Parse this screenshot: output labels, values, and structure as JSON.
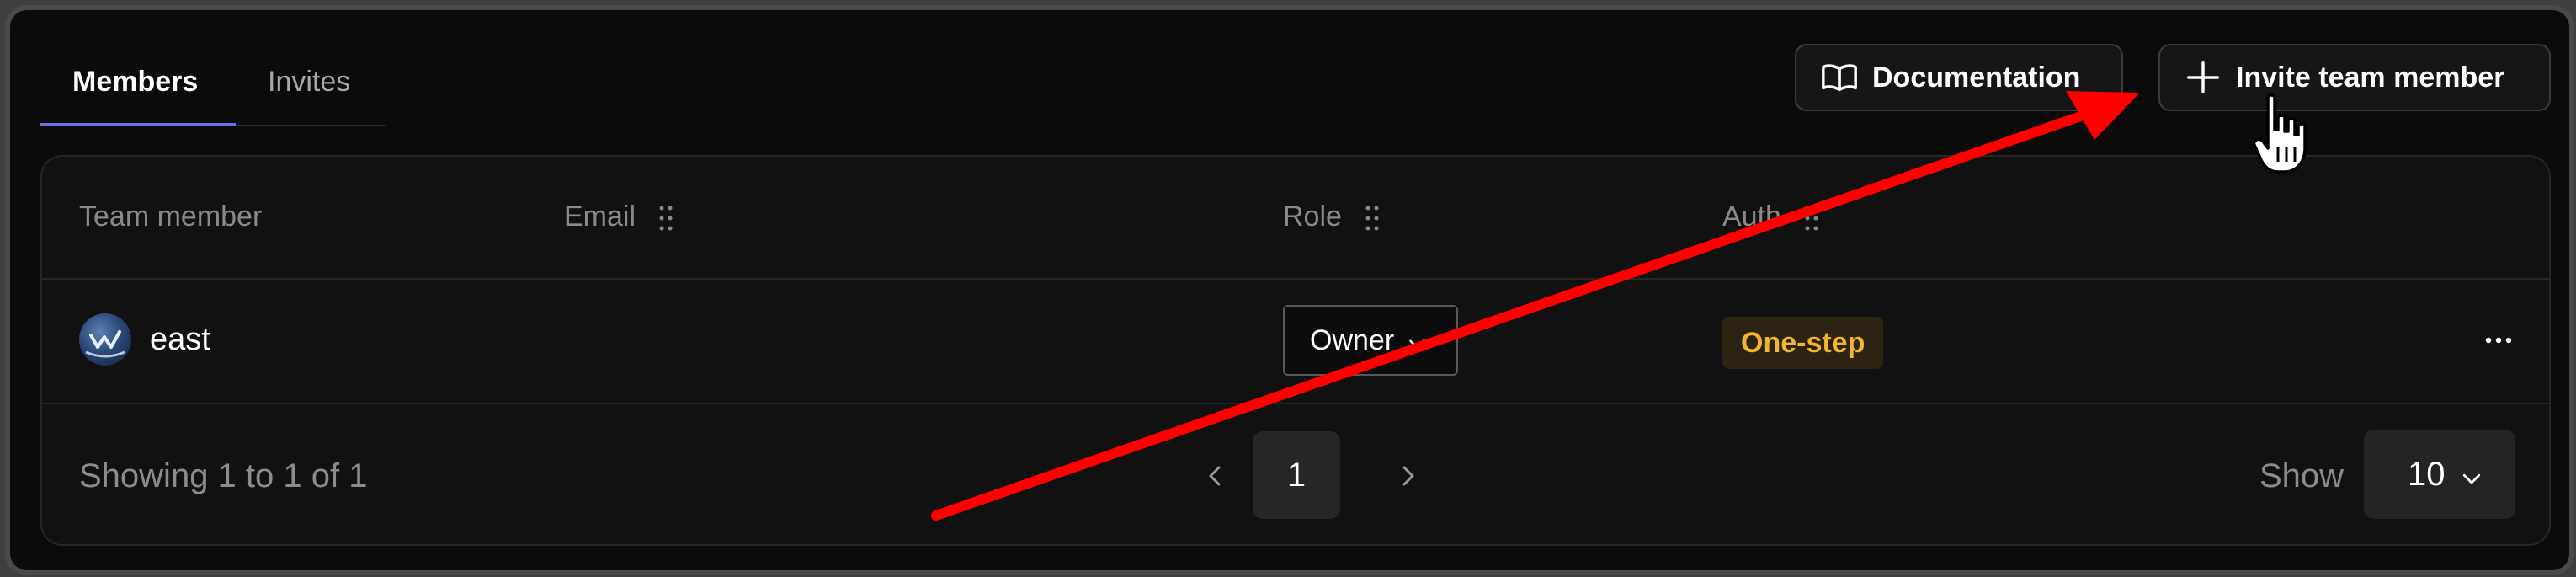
{
  "tabs": [
    {
      "label": "Members",
      "active": true
    },
    {
      "label": "Invites",
      "active": false
    }
  ],
  "header_buttons": {
    "documentation": {
      "label": "Documentation",
      "icon": "book-open-icon"
    },
    "invite": {
      "label": "Invite team member",
      "icon": "plus-icon"
    }
  },
  "table": {
    "columns": [
      "Team member",
      "Email",
      "Role",
      "Auth"
    ],
    "rows": [
      {
        "name": "east",
        "email": "",
        "role": "Owner",
        "auth": "One-step",
        "avatar": "avatar"
      }
    ]
  },
  "pagination": {
    "summary": "Showing 1 to 1 of 1",
    "current_page": "1",
    "show_label": "Show",
    "page_size": "10"
  },
  "colors": {
    "background": "#0b0b0b",
    "accent_underline": "#6b6ee8",
    "badge_text": "#f0b62d",
    "badge_bg": "#2d2312",
    "annotation_arrow": "#ff0000"
  }
}
